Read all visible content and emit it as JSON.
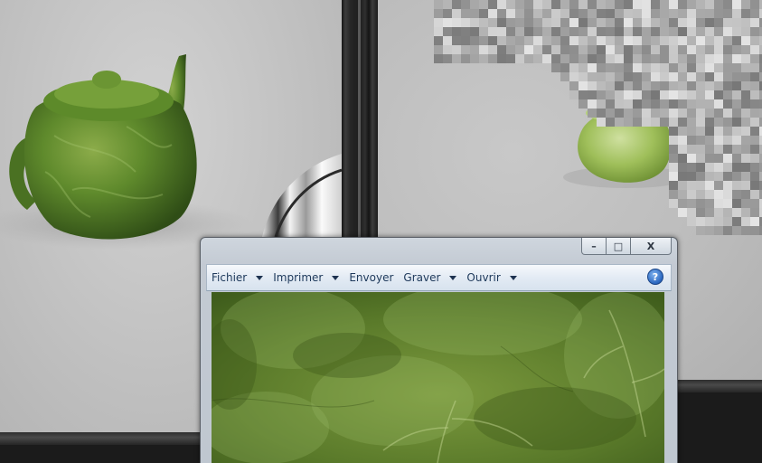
{
  "window": {
    "caption_buttons": {
      "minimize": "–",
      "maximize": "□",
      "close": "X"
    }
  },
  "menu_bar": {
    "items": [
      {
        "label": "Fichier",
        "has_dropdown": true
      },
      {
        "label": "Imprimer",
        "has_dropdown": true
      },
      {
        "label": "Envoyer",
        "has_dropdown": false
      },
      {
        "label": "Graver",
        "has_dropdown": true
      },
      {
        "label": "Ouvrir",
        "has_dropdown": true
      }
    ],
    "help_glyph": "?"
  },
  "icons": {
    "help": "help-icon",
    "dropdown": "chevron-down-icon"
  },
  "colors": {
    "menu_text": "#1e395b",
    "help_blue": "#2a66bf",
    "leaf_green": "#5d7a2d",
    "viewport_gray": "#c4c4c4"
  }
}
